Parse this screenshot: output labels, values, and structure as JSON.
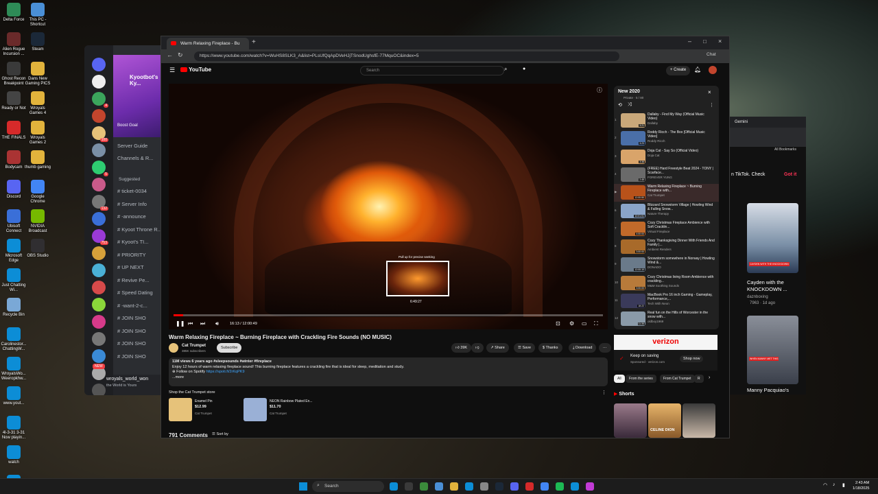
{
  "desktop_icons": [
    {
      "label": "Delta Force",
      "color": "#2e8b57"
    },
    {
      "label": "This PC - Shortcut",
      "color": "#4a8fd6"
    },
    {
      "label": "Alien Rogue Incursion ...",
      "color": "#6a2a2a"
    },
    {
      "label": "Steam",
      "color": "#1b2838"
    },
    {
      "label": "Ghost Recon Breakpoint",
      "color": "#3a3a3a"
    },
    {
      "label": "Dans New Gaming PICS",
      "color": "#e2b33c"
    },
    {
      "label": "Ready or Not",
      "color": "#444"
    },
    {
      "label": "Wroyals Games 4",
      "color": "#e2b33c"
    },
    {
      "label": "THE FINALS",
      "color": "#d62a2a"
    },
    {
      "label": "Wroyals Games 2",
      "color": "#e2b33c"
    },
    {
      "label": "Bodycam",
      "color": "#a33"
    },
    {
      "label": "thumb gaming",
      "color": "#e2b33c"
    },
    {
      "label": "Discord",
      "color": "#5865f2"
    },
    {
      "label": "Google Chrome",
      "color": "#4285f4"
    },
    {
      "label": "Ubisoft Connect",
      "color": "#3a6fd8"
    },
    {
      "label": "NVIDIA Broadcast",
      "color": "#76b900"
    },
    {
      "label": "Microsoft Edge",
      "color": "#0c8dd6"
    },
    {
      "label": "OBS Studio",
      "color": "#302e31"
    },
    {
      "label": "Just Chatting Wi...",
      "color": "#0c8dd6"
    },
    {
      "label": "Recycle Bin",
      "color": "#7aa8d6"
    },
    {
      "label": "Carolinestor... ChattingW...",
      "color": "#0c8dd6"
    },
    {
      "label": "WroyalsWo... Weeropkhw...",
      "color": "#0c8dd6"
    },
    {
      "label": "www.yout...",
      "color": "#0c8dd6"
    },
    {
      "label": "4l-3-31 3-31 Now playin...",
      "color": "#0c8dd6"
    },
    {
      "label": "watch",
      "color": "#0c8dd6"
    },
    {
      "label": "Settings",
      "color": "#0c8dd6"
    }
  ],
  "discord": {
    "server_name": "Kyootbot's Ky...",
    "boost_goal": "Boost Goal",
    "server_guide": "Server Guide",
    "channels_roles": "Channels & R...",
    "suggested": "Suggested",
    "channels": [
      "ticket-0034",
      "Server Info",
      "-announce",
      "Kyoot Throne R...",
      "Kyoot's TI...",
      "PRIORITY",
      "UP NEXT",
      "Revive Pe...",
      "Speed Dating",
      "-want-2-c...",
      "JOIN SHO",
      "JOIN SHO",
      "JOIN SHO",
      "JOIN SHO"
    ],
    "new_badge": "NEW",
    "username": "wroyals_world_won",
    "status": "the World is Yours",
    "server_badges": [
      "4",
      "100",
      "5",
      "132",
      "753",
      "25",
      "221",
      "149",
      "78",
      "32"
    ]
  },
  "browser": {
    "tab_title": "Warm Relaxing Fireplace - Bu",
    "url": "https://www.youtube.com/watch?v=WuHS8SLK3_A&list=PLsUfQqApDVeHJjTSnodUghsfE-77MquOC&index=5",
    "copilot_label": "Chat"
  },
  "youtube": {
    "logo": "YouTube",
    "search_placeholder": "Search",
    "create_label": "Create",
    "pull_up_hint": "Pull up for precise seeking",
    "preview_time": "6:49:27",
    "time_display": "16:13 / 12:00:49",
    "progress_fraction": 0.022,
    "video_title": "Warm Relaxing Fireplace ~ Burning Fireplace with Crackling Fire Sounds (NO MUSIC)",
    "channel": "Cat Trumpet",
    "subscribers": "385K subscribers",
    "subscribe_label": "Subscribe",
    "likes": "39K",
    "share_label": "Share",
    "save_label": "Save",
    "thanks_label": "Thanks",
    "download_label": "Download",
    "views_line": "11M views  6 years ago  #sleepsounds #winter #fireplace",
    "description": "Enjoy 12 hours of warm relaxing fireplace sound! This burning fireplace features a crackling fire that is ideal for sleep, meditation and study.",
    "spotify_line": "Follow on Spotify",
    "spotify_link": "https://spoti.fi/2rKqPK9",
    "more_label": "...more",
    "store_header": "Shop the Cat Trumpet store",
    "products": [
      {
        "name": "Enamel Pin",
        "price": "$12.99",
        "seller": "Cat Trumpet"
      },
      {
        "name": "NEON Rainbow Plated En...",
        "price": "$11.70",
        "seller": "Cat Trumpet"
      }
    ],
    "comments_count": "791 Comments",
    "sort_label": "Sort by"
  },
  "playlist": {
    "title": "New 2020",
    "meta": "Private · 5 / 80",
    "items": [
      {
        "index": "1",
        "title": "Dallaby - Find My Way (Official Music Video)",
        "channel": "Dallaby",
        "duration": "3:21",
        "color": "#c9a87a"
      },
      {
        "index": "2",
        "title": "Roddy Ricch - The Box [Official Music Video]",
        "channel": "Roddy Ricch",
        "duration": "3:23",
        "color": "#4a6fa8"
      },
      {
        "index": "3",
        "title": "Doja Cat - Say So (Official Video)",
        "channel": "Doja Cat",
        "duration": "3:38",
        "color": "#d9a46a"
      },
      {
        "index": "4",
        "title": "(FREE) Hard Freestyle Beat 2024 - TONY | Scarface...",
        "channel": "FOREVER YUNG",
        "duration": "2:45",
        "color": "#6a6a6a"
      },
      {
        "index": "▶",
        "title": "Warm Relaxing Fireplace ~ Burning Fireplace with...",
        "channel": "Cat Trumpet",
        "duration": "12:00:50",
        "color": "#b8521a"
      },
      {
        "index": "6",
        "title": "Blizzard Snowstorm Village | Howling Wind & Falling Snow...",
        "channel": "Nature Therapy",
        "duration": "10:01:01",
        "color": "#8aa4c8"
      },
      {
        "index": "7",
        "title": "Cozy Christmas Fireplace Ambience with Soft Cracklin...",
        "channel": "Virtual Fireplace",
        "duration": "4:00:00",
        "color": "#c26a2a"
      },
      {
        "index": "8",
        "title": "Cozy Thanksgiving Dinner With Friends And Family |...",
        "channel": "Ambient Renders",
        "duration": "3:00:00",
        "color": "#a86a2a"
      },
      {
        "index": "9",
        "title": "Snowstorm somewhere in Norway | Howling Wind &...",
        "channel": "DONADO",
        "duration": "12:00:10",
        "color": "#6a7a8a"
      },
      {
        "index": "10",
        "title": "Cozy Christmas living Room Ambience with crackling...",
        "channel": "M&M Soothing Sounds",
        "duration": "3:00:00",
        "color": "#b87a3a"
      },
      {
        "index": "11",
        "title": "MacBook Pro 16 inch Gaming - Gameplay, Performance,...",
        "channel": "Tech With Neon",
        "duration": "18:22",
        "color": "#3a3a5a"
      },
      {
        "index": "12",
        "title": "Real fun on the Hills of Worcester in the snow with...",
        "channel": "oldboy1969",
        "duration": "11:35",
        "color": "#8a9aa8"
      }
    ]
  },
  "ad": {
    "brand": "verizon",
    "headline": "Keep on saving",
    "sponsor": "Sponsored · verizon.com",
    "cta": "Shop now"
  },
  "chips": [
    "All",
    "From the series",
    "From Cat Trumpet",
    "R"
  ],
  "shorts_header": "Shorts",
  "shorts_text": "CELINE DION",
  "gemini": {
    "title": "Gemini",
    "all_bookmarks": "All Bookmarks",
    "banner_text": "n TikTok. Check",
    "got_it": "Got it",
    "video_title": "Cayden with the KNOCKDOWN ...",
    "video_channel": "daznboxing",
    "video_meta": "7963 · 1d ago",
    "second_title": "Manny Pacquiao's",
    "thumb_caption": "CAYDEN WITH THE KNOCKDOWN",
    "thumb_caption_2": "WHEN MANNY MET THIS"
  },
  "taskbar": {
    "search_label": "Search",
    "time": "2:43 AM",
    "date": "1/18/2025",
    "icon_colors": [
      "#0c8dd6",
      "#3a3a3a",
      "#3b8b3b",
      "#4a8fd6",
      "#e2b33c",
      "#0c8dd6",
      "#888",
      "#1b2838",
      "#5865f2",
      "#d62a2a",
      "#4285f4",
      "#1db954",
      "#0c8dd6",
      "#c23bd6"
    ]
  }
}
